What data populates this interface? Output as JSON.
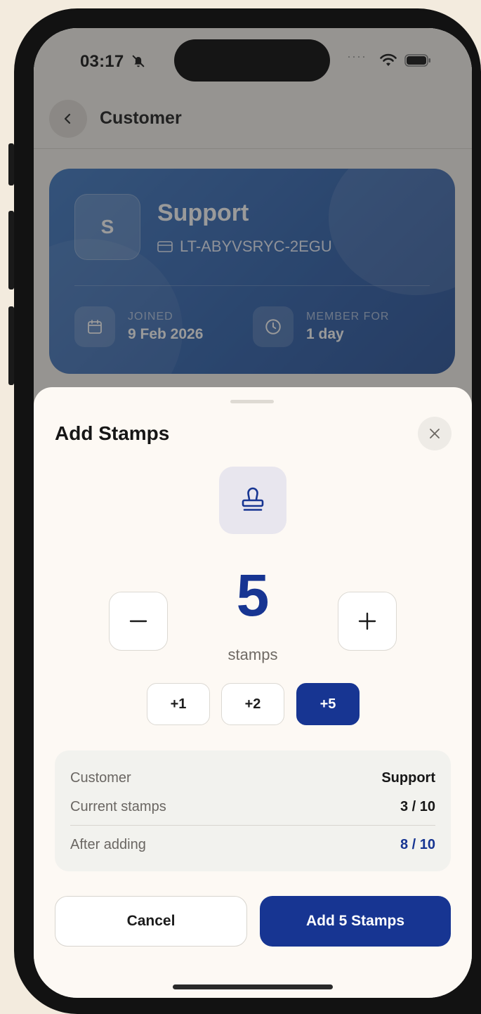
{
  "status_bar": {
    "time": "03:17"
  },
  "nav": {
    "title": "Customer"
  },
  "card": {
    "initial": "S",
    "name": "Support",
    "card_id": "LT-ABYVSRYC-2EGU",
    "joined_label": "JOINED",
    "joined_value": "9 Feb 2026",
    "member_label": "MEMBER FOR",
    "member_value": "1 day"
  },
  "sheet": {
    "title": "Add Stamps",
    "count": "5",
    "count_unit": "stamps",
    "chips": [
      "+1",
      "+2",
      "+5"
    ],
    "selected_chip": "+5",
    "summary": {
      "customer_label": "Customer",
      "customer_value": "Support",
      "current_label": "Current stamps",
      "current_value": "3 / 10",
      "after_label": "After adding",
      "after_value": "8 / 10"
    },
    "cancel_label": "Cancel",
    "add_label": "Add 5 Stamps"
  },
  "colors": {
    "accent": "#173592",
    "card_blue": "#2e61ad"
  }
}
